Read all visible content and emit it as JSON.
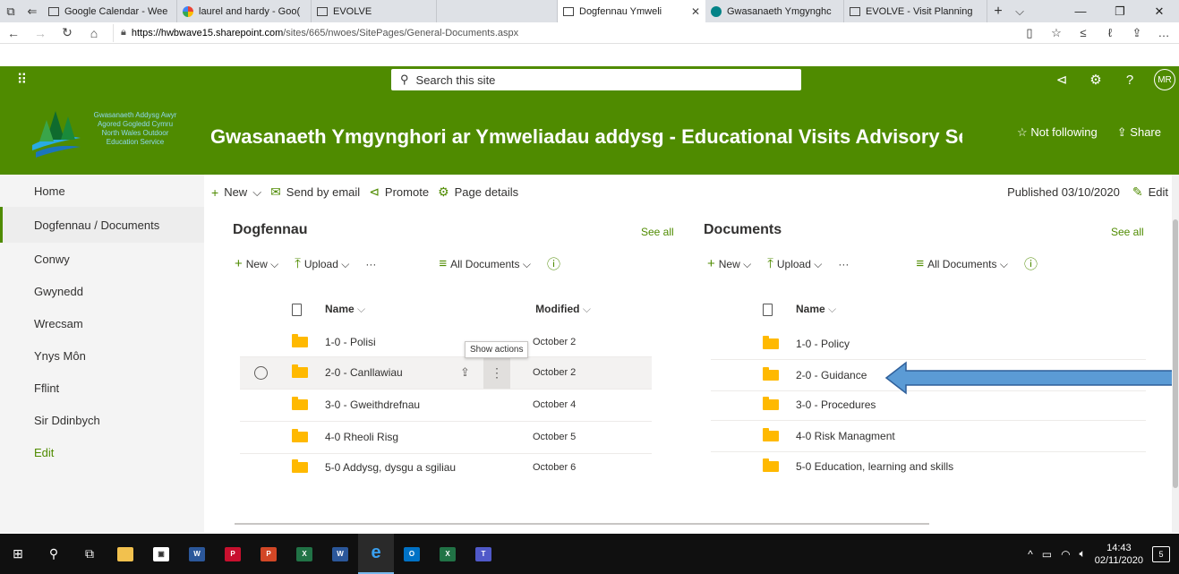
{
  "browser": {
    "tabs": [
      {
        "title": "Google Calendar - Wee",
        "active": false
      },
      {
        "title": "laurel and hardy - Goo(",
        "active": false
      },
      {
        "title": "EVOLVE",
        "active": false
      },
      {
        "title": "Dogfennau Ymweli",
        "active": true
      },
      {
        "title": "Gwasanaeth Ymgynghc",
        "active": false
      },
      {
        "title": "EVOLVE - Visit Planning",
        "active": false
      }
    ],
    "url_host": "https://hwbwave15.sharepoint.com",
    "url_path": "/sites/665/nwoes/SitePages/General-Documents.aspx"
  },
  "suitebar": {
    "search_placeholder": "Search this site",
    "avatar_initials": "MR"
  },
  "site": {
    "logo_text_lines": [
      "Gwasanaeth Addysg Awyr",
      "Agored Gogledd Cymru",
      "North Wales Outdoor",
      "Education Service"
    ],
    "title": "Gwasanaeth Ymgynghori ar Ymweliadau addysg - Educational Visits Advisory Se…",
    "not_following": "Not following",
    "share": "Share"
  },
  "leftnav": {
    "items": [
      "Home",
      "Dogfennau / Documents",
      "Conwy",
      "Gwynedd",
      "Wrecsam",
      "Ynys Môn",
      "Fflint",
      "Sir Ddinbych",
      "Edit"
    ]
  },
  "commandbar": {
    "new": "New",
    "send_by_email": "Send by email",
    "promote": "Promote",
    "page_details": "Page details",
    "published": "Published 03/10/2020",
    "edit": "Edit"
  },
  "library_left": {
    "title": "Dogfennau",
    "see_all": "See all",
    "new": "New",
    "upload": "Upload",
    "ellipsis": "···",
    "view": "All Documents",
    "col_name": "Name",
    "col_modified": "Modified",
    "tooltip": "Show actions",
    "rows": [
      {
        "name": "1-0 - Polisi",
        "modified": "October 2"
      },
      {
        "name": "2-0 - Canllawiau",
        "modified": "October 2"
      },
      {
        "name": "3-0 - Gweithdrefnau",
        "modified": "October 4"
      },
      {
        "name": "4-0 Rheoli Risg",
        "modified": "October 5"
      },
      {
        "name": "5-0 Addysg, dysgu a sgiliau",
        "modified": "October 6"
      }
    ]
  },
  "library_right": {
    "title": "Documents",
    "see_all": "See all",
    "new": "New",
    "upload": "Upload",
    "ellipsis": "···",
    "view": "All Documents",
    "col_name": "Name",
    "rows": [
      {
        "name": "1-0 - Policy"
      },
      {
        "name": "2-0 - Guidance"
      },
      {
        "name": "3-0 - Procedures"
      },
      {
        "name": "4-0 Risk Managment"
      },
      {
        "name": "5-0 Education, learning and skills"
      }
    ]
  },
  "taskbar": {
    "time": "14:43",
    "date": "02/11/2020",
    "notifications": "5"
  },
  "colors": {
    "theme_green": "#4f8b00",
    "arrow_blue": "#5b9bd5"
  }
}
